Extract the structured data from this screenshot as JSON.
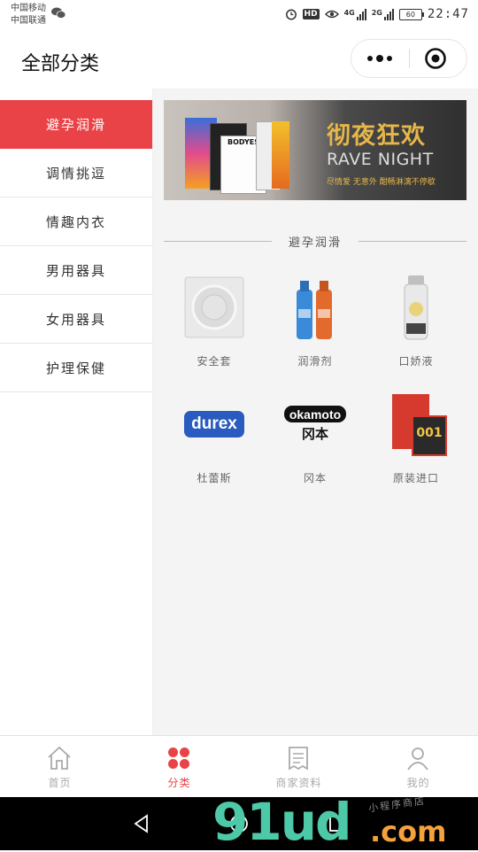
{
  "status": {
    "carrier1": "中国移动",
    "carrier2": "中国联通",
    "hd": "HD",
    "net1": "4G",
    "net2": "2G",
    "battery": "60",
    "time": "22:47"
  },
  "header": {
    "title": "全部分类"
  },
  "sidebar": {
    "items": [
      {
        "label": "避孕润滑",
        "active": true
      },
      {
        "label": "调情挑逗"
      },
      {
        "label": "情趣内衣"
      },
      {
        "label": "男用器具"
      },
      {
        "label": "女用器具"
      },
      {
        "label": "护理保健"
      }
    ]
  },
  "banner": {
    "title": "彻夜狂欢",
    "subtitle": "RAVE NIGHT",
    "caption": "尽情爱 无意外 酣畅淋漓不停歇",
    "box_label": "BODYES"
  },
  "section": {
    "title": "避孕润滑"
  },
  "products": [
    {
      "label": "安全套",
      "icon": "condom-package-icon"
    },
    {
      "label": "润滑剂",
      "icon": "lubricant-bottles-icon"
    },
    {
      "label": "口娇液",
      "icon": "oral-gel-bottle-icon"
    },
    {
      "label": "杜蕾斯",
      "icon": "durex-logo",
      "logo_text": "durex"
    },
    {
      "label": "冈本",
      "icon": "okamoto-logo",
      "logo_text": "okamoto",
      "logo_cn": "冈本"
    },
    {
      "label": "原装进口",
      "icon": "imported-box-icon",
      "box_text": "001"
    }
  ],
  "tabbar": {
    "tabs": [
      {
        "label": "首页",
        "icon": "home-icon"
      },
      {
        "label": "分类",
        "icon": "category-icon",
        "active": true
      },
      {
        "label": "商家资料",
        "icon": "document-icon"
      },
      {
        "label": "我的",
        "icon": "user-icon"
      }
    ]
  },
  "watermark": {
    "main": "91ud",
    "suffix": ".com",
    "tagline": "小程序商店"
  },
  "colors": {
    "accent": "#e94347",
    "banner_gold": "#e6b648"
  }
}
